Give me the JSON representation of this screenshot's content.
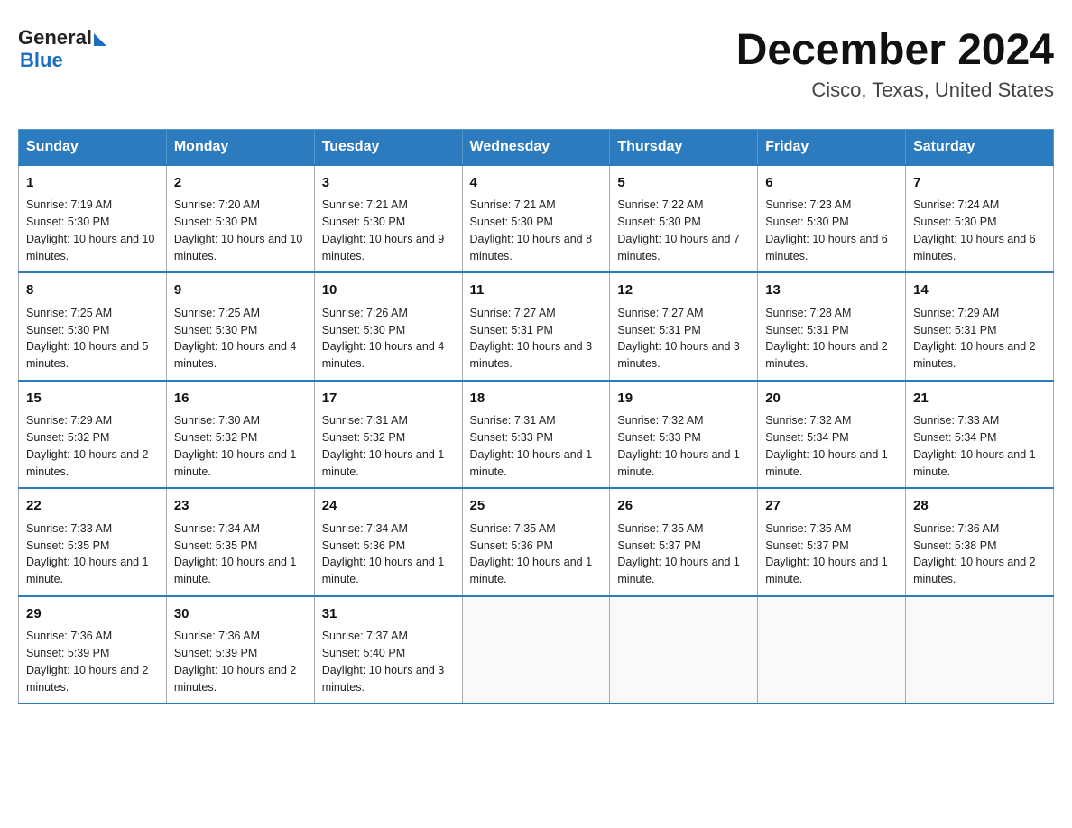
{
  "header": {
    "title": "December 2024",
    "subtitle": "Cisco, Texas, United States",
    "logo_general": "General",
    "logo_blue": "Blue"
  },
  "weekdays": [
    "Sunday",
    "Monday",
    "Tuesday",
    "Wednesday",
    "Thursday",
    "Friday",
    "Saturday"
  ],
  "weeks": [
    [
      {
        "day": "1",
        "sunrise": "7:19 AM",
        "sunset": "5:30 PM",
        "daylight": "10 hours and 10 minutes."
      },
      {
        "day": "2",
        "sunrise": "7:20 AM",
        "sunset": "5:30 PM",
        "daylight": "10 hours and 10 minutes."
      },
      {
        "day": "3",
        "sunrise": "7:21 AM",
        "sunset": "5:30 PM",
        "daylight": "10 hours and 9 minutes."
      },
      {
        "day": "4",
        "sunrise": "7:21 AM",
        "sunset": "5:30 PM",
        "daylight": "10 hours and 8 minutes."
      },
      {
        "day": "5",
        "sunrise": "7:22 AM",
        "sunset": "5:30 PM",
        "daylight": "10 hours and 7 minutes."
      },
      {
        "day": "6",
        "sunrise": "7:23 AM",
        "sunset": "5:30 PM",
        "daylight": "10 hours and 6 minutes."
      },
      {
        "day": "7",
        "sunrise": "7:24 AM",
        "sunset": "5:30 PM",
        "daylight": "10 hours and 6 minutes."
      }
    ],
    [
      {
        "day": "8",
        "sunrise": "7:25 AM",
        "sunset": "5:30 PM",
        "daylight": "10 hours and 5 minutes."
      },
      {
        "day": "9",
        "sunrise": "7:25 AM",
        "sunset": "5:30 PM",
        "daylight": "10 hours and 4 minutes."
      },
      {
        "day": "10",
        "sunrise": "7:26 AM",
        "sunset": "5:30 PM",
        "daylight": "10 hours and 4 minutes."
      },
      {
        "day": "11",
        "sunrise": "7:27 AM",
        "sunset": "5:31 PM",
        "daylight": "10 hours and 3 minutes."
      },
      {
        "day": "12",
        "sunrise": "7:27 AM",
        "sunset": "5:31 PM",
        "daylight": "10 hours and 3 minutes."
      },
      {
        "day": "13",
        "sunrise": "7:28 AM",
        "sunset": "5:31 PM",
        "daylight": "10 hours and 2 minutes."
      },
      {
        "day": "14",
        "sunrise": "7:29 AM",
        "sunset": "5:31 PM",
        "daylight": "10 hours and 2 minutes."
      }
    ],
    [
      {
        "day": "15",
        "sunrise": "7:29 AM",
        "sunset": "5:32 PM",
        "daylight": "10 hours and 2 minutes."
      },
      {
        "day": "16",
        "sunrise": "7:30 AM",
        "sunset": "5:32 PM",
        "daylight": "10 hours and 1 minute."
      },
      {
        "day": "17",
        "sunrise": "7:31 AM",
        "sunset": "5:32 PM",
        "daylight": "10 hours and 1 minute."
      },
      {
        "day": "18",
        "sunrise": "7:31 AM",
        "sunset": "5:33 PM",
        "daylight": "10 hours and 1 minute."
      },
      {
        "day": "19",
        "sunrise": "7:32 AM",
        "sunset": "5:33 PM",
        "daylight": "10 hours and 1 minute."
      },
      {
        "day": "20",
        "sunrise": "7:32 AM",
        "sunset": "5:34 PM",
        "daylight": "10 hours and 1 minute."
      },
      {
        "day": "21",
        "sunrise": "7:33 AM",
        "sunset": "5:34 PM",
        "daylight": "10 hours and 1 minute."
      }
    ],
    [
      {
        "day": "22",
        "sunrise": "7:33 AM",
        "sunset": "5:35 PM",
        "daylight": "10 hours and 1 minute."
      },
      {
        "day": "23",
        "sunrise": "7:34 AM",
        "sunset": "5:35 PM",
        "daylight": "10 hours and 1 minute."
      },
      {
        "day": "24",
        "sunrise": "7:34 AM",
        "sunset": "5:36 PM",
        "daylight": "10 hours and 1 minute."
      },
      {
        "day": "25",
        "sunrise": "7:35 AM",
        "sunset": "5:36 PM",
        "daylight": "10 hours and 1 minute."
      },
      {
        "day": "26",
        "sunrise": "7:35 AM",
        "sunset": "5:37 PM",
        "daylight": "10 hours and 1 minute."
      },
      {
        "day": "27",
        "sunrise": "7:35 AM",
        "sunset": "5:37 PM",
        "daylight": "10 hours and 1 minute."
      },
      {
        "day": "28",
        "sunrise": "7:36 AM",
        "sunset": "5:38 PM",
        "daylight": "10 hours and 2 minutes."
      }
    ],
    [
      {
        "day": "29",
        "sunrise": "7:36 AM",
        "sunset": "5:39 PM",
        "daylight": "10 hours and 2 minutes."
      },
      {
        "day": "30",
        "sunrise": "7:36 AM",
        "sunset": "5:39 PM",
        "daylight": "10 hours and 2 minutes."
      },
      {
        "day": "31",
        "sunrise": "7:37 AM",
        "sunset": "5:40 PM",
        "daylight": "10 hours and 3 minutes."
      },
      null,
      null,
      null,
      null
    ]
  ],
  "labels": {
    "sunrise": "Sunrise:",
    "sunset": "Sunset:",
    "daylight": "Daylight:"
  }
}
